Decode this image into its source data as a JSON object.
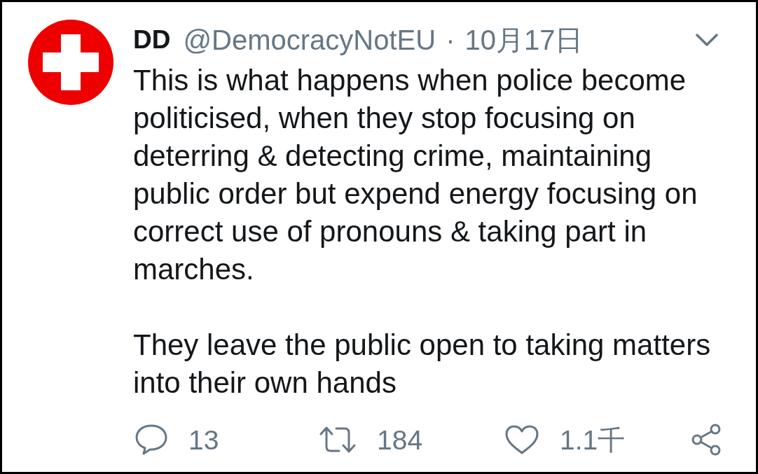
{
  "tweet": {
    "author": {
      "name": "DD",
      "handle": "@DemocracyNotEU"
    },
    "separator": "·",
    "date": "10月17日",
    "paragraphs": [
      "This is what happens when police become politicised, when they stop focusing on deterring & detecting crime, maintaining public order but expend energy focusing on correct use of pronouns & taking part in marches.",
      "They leave the public open to taking matters into their own hands"
    ],
    "actions": [
      {
        "kind": "reply",
        "count": "13"
      },
      {
        "kind": "retweet",
        "count": "184"
      },
      {
        "kind": "like",
        "count": "1.1千"
      },
      {
        "kind": "share"
      }
    ]
  }
}
